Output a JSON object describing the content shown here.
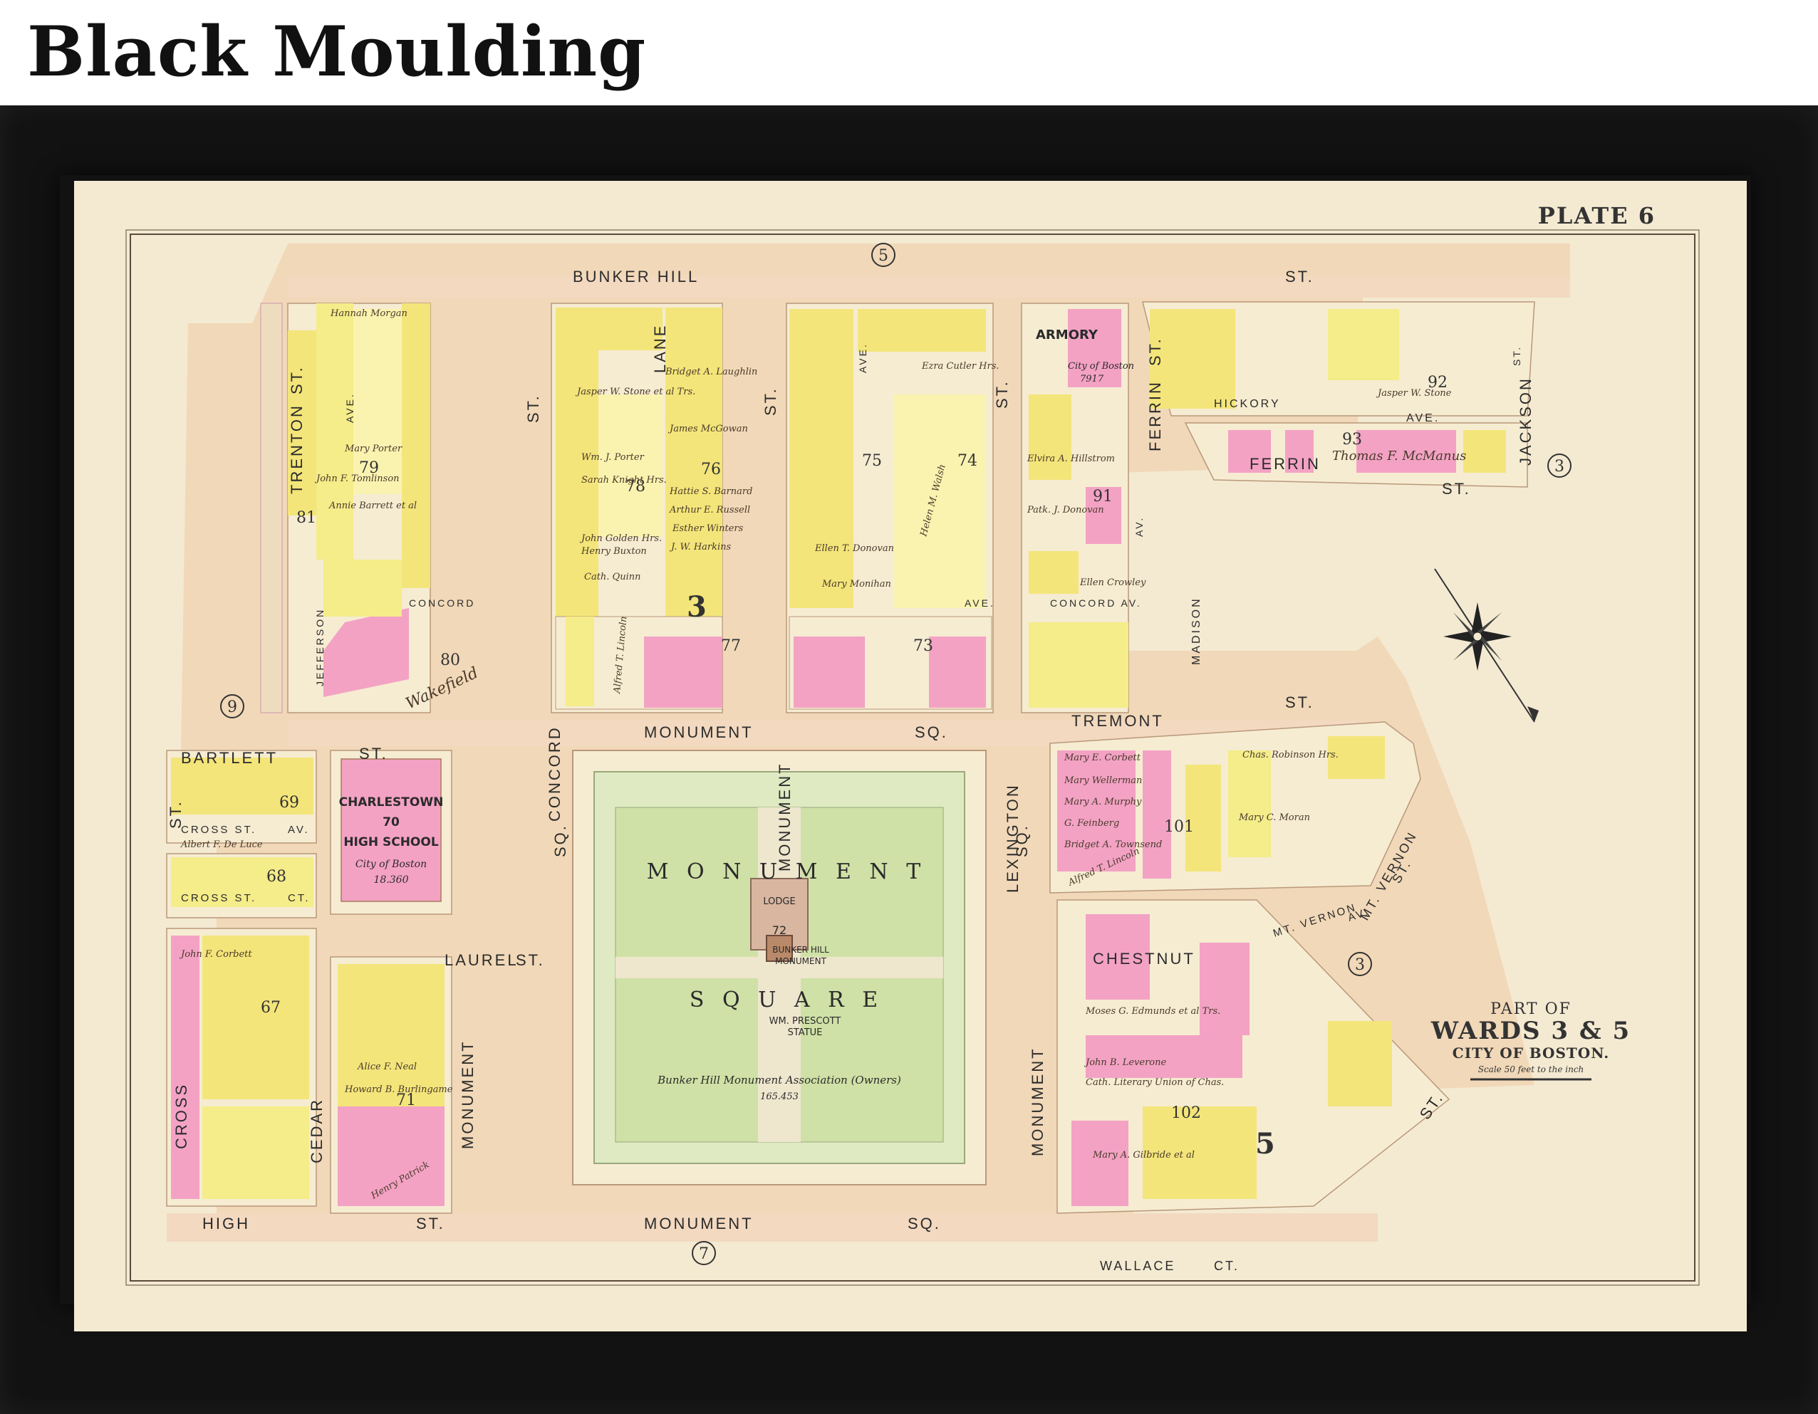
{
  "page": {
    "heading": "Black Moulding"
  },
  "map": {
    "plate": "PLATE 6",
    "title_lines": [
      "PART OF",
      "WARDS 3 & 5",
      "CITY OF BOSTON."
    ],
    "scale_text": "Scale 50 feet to the inch",
    "streets": [
      {
        "name": "BUNKER HILL",
        "id": "bunker-hill"
      },
      {
        "name": "ST.",
        "id": "bunker-hill-st"
      },
      {
        "name": "TRENTON",
        "id": "trenton"
      },
      {
        "name": "ST.",
        "id": "trenton-st"
      },
      {
        "name": "CONCORD",
        "id": "concord"
      },
      {
        "name": "ST.",
        "id": "concord-st"
      },
      {
        "name": "LANE",
        "id": "lane"
      },
      {
        "name": "MONUMENT",
        "id": "monument-v"
      },
      {
        "name": "ST.",
        "id": "monument-st"
      },
      {
        "name": "LEXINGTON",
        "id": "lexington"
      },
      {
        "name": "ST.",
        "id": "lexington-st"
      },
      {
        "name": "FERRIN",
        "id": "ferrin"
      },
      {
        "name": "ST.",
        "id": "ferrin-st"
      },
      {
        "name": "JACKSON",
        "id": "jackson"
      },
      {
        "name": "HICKORY",
        "id": "hickory"
      },
      {
        "name": "AVE.",
        "id": "hickory-ave"
      },
      {
        "name": "FERRIN",
        "id": "ferrin-h"
      },
      {
        "name": "ST.",
        "id": "ferrin-h-st"
      },
      {
        "name": "MONUMENT",
        "id": "monument-sq-n"
      },
      {
        "name": "SQ.",
        "id": "monument-sq-n-sq"
      },
      {
        "name": "TREMONT",
        "id": "tremont"
      },
      {
        "name": "ST.",
        "id": "tremont-st"
      },
      {
        "name": "BARTLETT",
        "id": "bartlett"
      },
      {
        "name": "ST.",
        "id": "bartlett-st"
      },
      {
        "name": "CROSS ST.",
        "id": "cross-st"
      },
      {
        "name": "AV.",
        "id": "cross-av"
      },
      {
        "name": "CROSS ST.",
        "id": "cross-st-2"
      },
      {
        "name": "CT.",
        "id": "cross-ct"
      },
      {
        "name": "LAUREL",
        "id": "laurel"
      },
      {
        "name": "ST.",
        "id": "laurel-st"
      },
      {
        "name": "CHESTNUT",
        "id": "chestnut"
      },
      {
        "name": "MT. VERNON",
        "id": "mt-vernon"
      },
      {
        "name": "ST.",
        "id": "mt-vernon-st"
      },
      {
        "name": "MT. VERNON",
        "id": "mt-vernon-av"
      },
      {
        "name": "AV.",
        "id": "mt-vernon-av-av"
      },
      {
        "name": "CROSS",
        "id": "cross-v"
      },
      {
        "name": "CEDAR",
        "id": "cedar"
      },
      {
        "name": "MONUMENT",
        "id": "monument-w"
      },
      {
        "name": "MONUMENT",
        "id": "monument-e"
      },
      {
        "name": "HIGH",
        "id": "high"
      },
      {
        "name": "ST.",
        "id": "high-st"
      },
      {
        "name": "MONUMENT",
        "id": "monument-sq-s"
      },
      {
        "name": "SQ.",
        "id": "monument-sq-s-sq"
      },
      {
        "name": "WALLACE",
        "id": "wallace"
      },
      {
        "name": "CT.",
        "id": "wallace-ct"
      },
      {
        "name": "SQ.",
        "id": "sq-w"
      },
      {
        "name": "SQ.",
        "id": "sq-e"
      },
      {
        "name": "ST.",
        "id": "st-sw"
      },
      {
        "name": "ST.",
        "id": "st-se"
      },
      {
        "name": "CONCORD",
        "id": "concord-h"
      },
      {
        "name": "AVE.",
        "id": "concord-ave"
      },
      {
        "name": "CONCORD AV.",
        "id": "concord-av-e"
      },
      {
        "name": "MADISON",
        "id": "madison"
      },
      {
        "name": "JEFFERSON",
        "id": "jefferson"
      },
      {
        "name": "AVE.",
        "id": "ave-79"
      },
      {
        "name": "AVE.",
        "id": "ave-lex"
      },
      {
        "name": "AV.",
        "id": "av-ferrin"
      },
      {
        "name": "ST.",
        "id": "st-jackson"
      }
    ],
    "ward_circles": [
      "5",
      "9",
      "3",
      "3",
      "7"
    ],
    "block_numbers": [
      "79",
      "78",
      "76",
      "75",
      "74",
      "77",
      "73",
      "80",
      "81",
      "92",
      "93",
      "91",
      "101",
      "102",
      "69",
      "68",
      "67",
      "71",
      "70",
      "72"
    ],
    "ward_numbers_large": [
      "3",
      "5"
    ],
    "landmarks": {
      "armory": "ARMORY",
      "armory_owner": "City of Boston",
      "armory_area": "7917",
      "school_line1": "CHARLESTOWN",
      "school_line2": "70",
      "school_line3": "HIGH SCHOOL",
      "school_owner": "City of Boston",
      "school_area": "18.360",
      "square_word1": "M O N U M E N T",
      "square_word2": "S Q U A R E",
      "lodge": "LODGE",
      "monument_num": "72",
      "monument_line1": "BUNKER HILL",
      "monument_line2": "MONUMENT",
      "statue_line1": "WM. PRESCOTT",
      "statue_line2": "STATUE",
      "association": "Bunker Hill Monument Association (Owners)",
      "square_area": "165.453"
    },
    "owners": [
      "Hannah Morgan",
      "Mary Porter",
      "John F. Tomlinson",
      "Annie Barrett et al",
      "Jasper W. Stone et al Trs.",
      "Wm. J. Porter",
      "Sarah Knight Hrs.",
      "John Golden Hrs.",
      "Henry Buxton",
      "Cath. Quinn",
      "Bridget A. Laughlin",
      "James McGowan",
      "Hattie S. Barnard",
      "Arthur E. Russell",
      "Esther Winters",
      "J. W. Harkins",
      "Ellen T. Donovan",
      "Mary Monihan",
      "Ezra Cutler Hrs.",
      "Helen M. Walsh",
      "Alfred T. Lincoln",
      "Mary E. Corbett",
      "Mary Wellerman",
      "Mary A. Murphy",
      "G. Feinberg",
      "Bridget A. Townsend",
      "Alfred T. Lincoln",
      "Moses G. Edmunds et al Trs.",
      "John B. Leverone",
      "Cath. Literary Union of Chas.",
      "Mary A. Gilbride et al",
      "Thomas F. McManus",
      "Jasper W. Stone",
      "Alice F. Neal",
      "Howard B. Burlingame",
      "Henry Patrick",
      "Elvira A. Hillstrom",
      "Patk. J. Donovan",
      "Ellen Crowley",
      "Albert F. De Luce",
      "John F. Corbett",
      "Wakefield",
      "Mary C. Moran",
      "Chas. Robinson Hrs."
    ]
  }
}
